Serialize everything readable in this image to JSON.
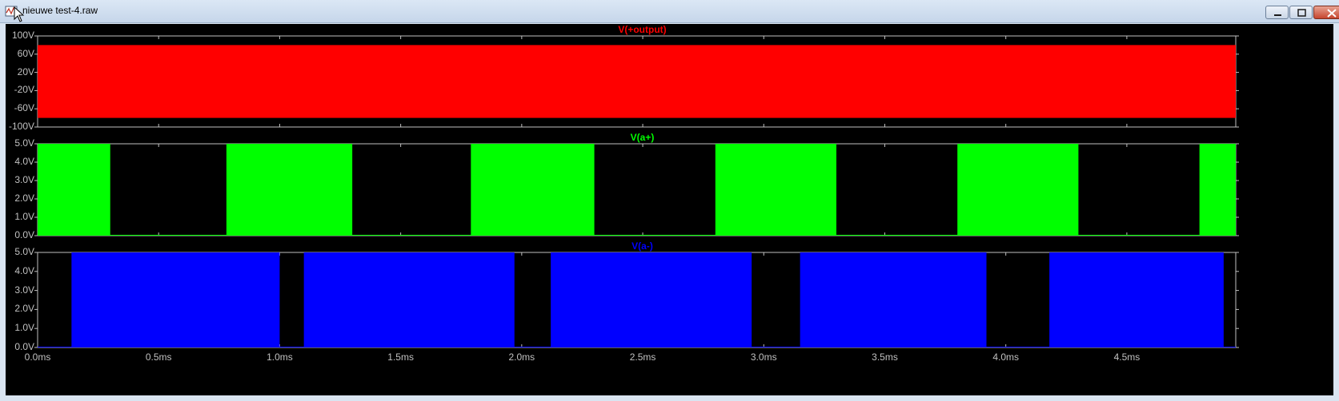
{
  "window": {
    "title": "nieuwe test-4.raw",
    "buttons": [
      "minimize",
      "maximize",
      "close"
    ]
  },
  "colors": {
    "background": "#000000",
    "axis": "#c0c0c0",
    "trace_output": "#ff0000",
    "trace_a_plus": "#00ff00",
    "trace_a_minus": "#0000ff"
  },
  "panes": [
    {
      "title": "V(+output)",
      "color": "#ff0000",
      "yticks": [
        "100V",
        "60V",
        "20V",
        "-20V",
        "-60V",
        "-100V"
      ]
    },
    {
      "title": "V(a+)",
      "color": "#00ff00",
      "yticks": [
        "5.0V",
        "4.0V",
        "3.0V",
        "2.0V",
        "1.0V",
        "0.0V"
      ]
    },
    {
      "title": "V(a-)",
      "color": "#0000ff",
      "yticks": [
        "5.0V",
        "4.0V",
        "3.0V",
        "2.0V",
        "1.0V",
        "0.0V"
      ]
    }
  ],
  "xaxis": {
    "ticks": [
      "0.0ms",
      "0.5ms",
      "1.0ms",
      "1.5ms",
      "2.0ms",
      "2.5ms",
      "3.0ms",
      "3.5ms",
      "4.0ms",
      "4.5ms"
    ]
  },
  "chart_data": [
    {
      "type": "area",
      "title": "V(+output)",
      "xlim": [
        0,
        4.95
      ],
      "ylim": [
        -100,
        100
      ],
      "series": [
        {
          "name": "V(+output)",
          "envelope_min": -80,
          "envelope_max": 80,
          "x_start": 0,
          "x_end": 4.95
        }
      ]
    },
    {
      "type": "area",
      "title": "V(a+)",
      "xlim": [
        0,
        4.95
      ],
      "ylim": [
        0,
        5
      ],
      "series": [
        {
          "name": "V(a+)",
          "high": 5,
          "low": 0,
          "high_intervals": [
            [
              0,
              0.3
            ],
            [
              0.78,
              1.3
            ],
            [
              1.79,
              2.3
            ],
            [
              2.8,
              3.3
            ],
            [
              3.8,
              4.3
            ],
            [
              4.8,
              4.95
            ]
          ]
        }
      ]
    },
    {
      "type": "area",
      "title": "V(a-)",
      "xlim": [
        0,
        4.95
      ],
      "ylim": [
        0,
        5
      ],
      "series": [
        {
          "name": "V(a-)",
          "high": 5,
          "low": 0,
          "high_intervals": [
            [
              0.14,
              1.0
            ],
            [
              1.1,
              1.97
            ],
            [
              2.12,
              2.95
            ],
            [
              3.15,
              3.92
            ],
            [
              4.18,
              4.9
            ]
          ]
        }
      ]
    }
  ]
}
